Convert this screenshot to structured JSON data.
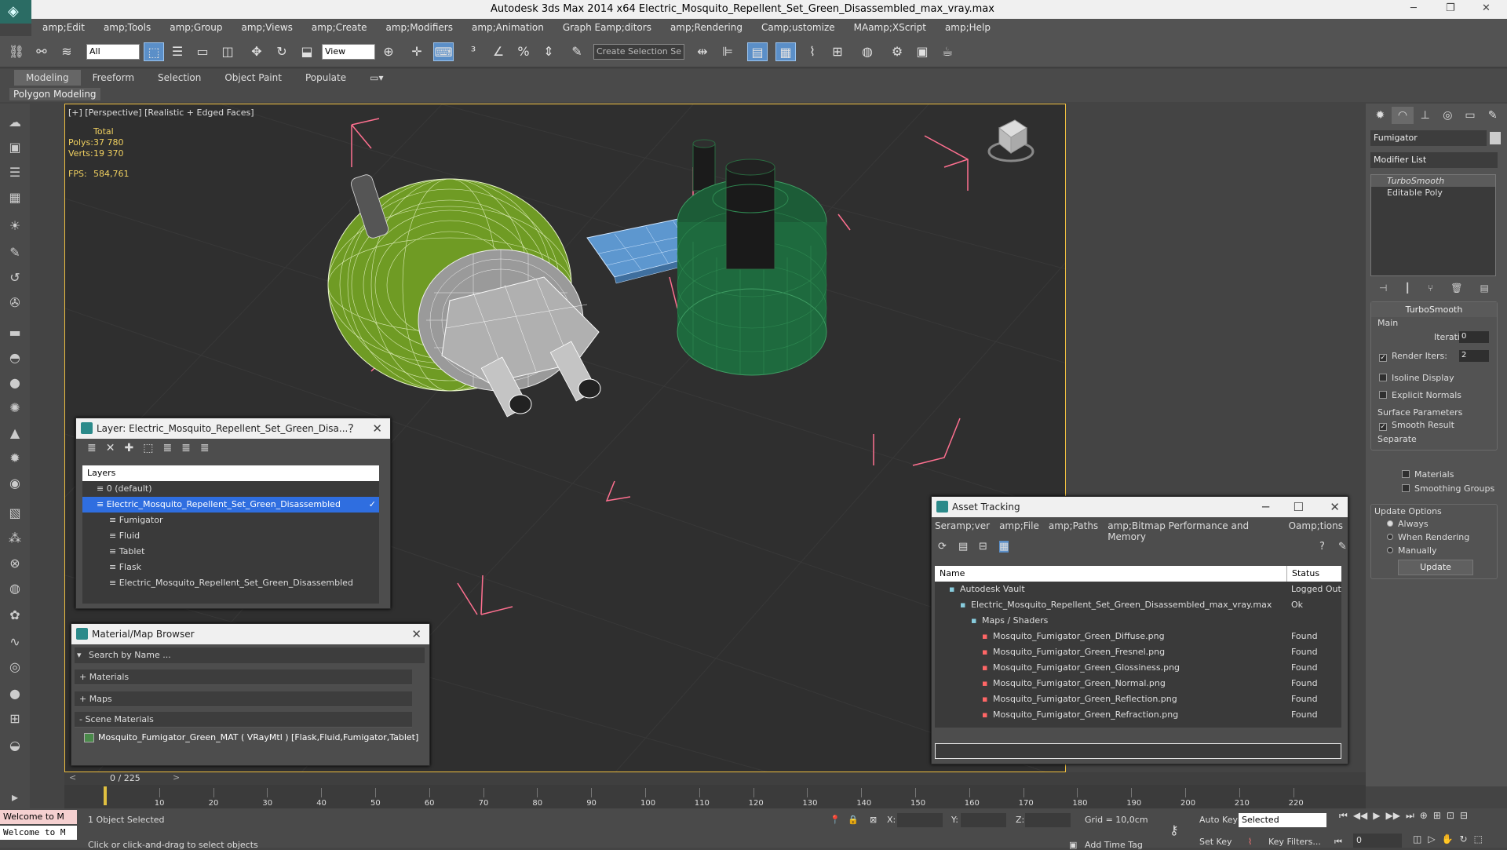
{
  "window": {
    "title": "Autodesk 3ds Max  2014 x64     Electric_Mosquito_Repellent_Set_Green_Disassembled_max_vray.max",
    "minimize": "─",
    "restore": "❐",
    "close": "✕"
  },
  "menu": [
    "amp;Edit",
    "amp;Tools",
    "amp;Group",
    "amp;Views",
    "amp;Create",
    "amp;Modifiers",
    "amp;Animation",
    "Graph Eamp;ditors",
    "amp;Rendering",
    "Camp;ustomize",
    "MAamp;XScript",
    "amp;Help"
  ],
  "toolbar": {
    "filter_select": "All",
    "ref_coord_select": "View",
    "selection_set_placeholder": "Create Selection Se"
  },
  "ribbon": {
    "tabs": [
      "Modeling",
      "Freeform",
      "Selection",
      "Object Paint",
      "Populate"
    ],
    "active_tab": "Modeling",
    "panel_label": "Polygon Modeling"
  },
  "viewport": {
    "label": "[+] [Perspective] [Realistic + Edged Faces]",
    "stats": {
      "total_label": "Total",
      "polys_label": "Polys:",
      "polys_value": "37 780",
      "verts_label": "Verts:",
      "verts_value": "19 370",
      "fps_label": "FPS:",
      "fps_value": "584,761"
    },
    "colors": {
      "background": "#2f2f2f",
      "grid": "#3a3a3a",
      "green_mesh": "#6f9b24",
      "plug_gray": "#a8a8a8",
      "tablet_blue": "#5d97cf",
      "flask_green": "#1e6a3e",
      "bbox_pink": "#ff7090"
    }
  },
  "command_panel": {
    "object_name": "Fumigator",
    "modifier_list": "Modifier List",
    "stack": [
      "TurboSmooth",
      "Editable Poly"
    ],
    "turbosmooth": {
      "title": "TurboSmooth",
      "main_label": "Main",
      "iterations_label": "Iterations:",
      "iterations_value": "0",
      "render_iters_label": "Render Iters:",
      "render_iters_value": "2",
      "isoline_label": "Isoline Display",
      "explicit_normals_label": "Explicit Normals",
      "surface_label": "Surface Parameters",
      "smooth_result_label": "Smooth Result",
      "separate_label": "Separate",
      "materials_label": "Materials",
      "smoothing_groups_label": "Smoothing Groups",
      "update_options_label": "Update Options",
      "always_label": "Always",
      "when_rendering_label": "When Rendering",
      "manually_label": "Manually",
      "update_button": "Update"
    }
  },
  "layer_window": {
    "title": "Layer: Electric_Mosquito_Repellent_Set_Green_Disa...",
    "help": "?",
    "header": "Layers",
    "rows": [
      {
        "label": "0 (default)",
        "indent": 0
      },
      {
        "label": "Electric_Mosquito_Repellent_Set_Green_Disassembled",
        "indent": 0,
        "selected": true
      },
      {
        "label": "Fumigator",
        "indent": 1
      },
      {
        "label": "Fluid",
        "indent": 1
      },
      {
        "label": "Tablet",
        "indent": 1
      },
      {
        "label": "Flask",
        "indent": 1
      },
      {
        "label": "Electric_Mosquito_Repellent_Set_Green_Disassembled",
        "indent": 1
      }
    ]
  },
  "material_browser": {
    "title": "Material/Map Browser",
    "search_placeholder": "Search by Name ...",
    "sections": [
      "+ Materials",
      "+ Maps",
      "- Scene Materials"
    ],
    "scene_material": "Mosquito_Fumigator_Green_MAT ( VRayMtl ) [Flask,Fluid,Fumigator,Tablet]"
  },
  "asset_tracking": {
    "title": "Asset Tracking",
    "menu": [
      "Seramp;ver",
      "amp;File",
      "amp;Paths",
      "amp;Bitmap Performance and Memory",
      "Oamp;tions"
    ],
    "columns": [
      "Name",
      "Status"
    ],
    "rows": [
      {
        "name": "Autodesk Vault",
        "status": "Logged Out",
        "indent": 1
      },
      {
        "name": "Electric_Mosquito_Repellent_Set_Green_Disassembled_max_vray.max",
        "status": "Ok",
        "indent": 2
      },
      {
        "name": "Maps / Shaders",
        "status": "",
        "indent": 3
      },
      {
        "name": "Mosquito_Fumigator_Green_Diffuse.png",
        "status": "Found",
        "indent": 4
      },
      {
        "name": "Mosquito_Fumigator_Green_Fresnel.png",
        "status": "Found",
        "indent": 4
      },
      {
        "name": "Mosquito_Fumigator_Green_Glossiness.png",
        "status": "Found",
        "indent": 4
      },
      {
        "name": "Mosquito_Fumigator_Green_Normal.png",
        "status": "Found",
        "indent": 4
      },
      {
        "name": "Mosquito_Fumigator_Green_Reflection.png",
        "status": "Found",
        "indent": 4
      },
      {
        "name": "Mosquito_Fumigator_Green_Refraction.png",
        "status": "Found",
        "indent": 4
      }
    ]
  },
  "timeline": {
    "frame_label": "0 / 225",
    "ticks": [
      "10",
      "20",
      "30",
      "40",
      "50",
      "60",
      "70",
      "80",
      "90",
      "100",
      "110",
      "120",
      "130",
      "140",
      "150",
      "160",
      "170",
      "180",
      "190",
      "200",
      "210",
      "220"
    ]
  },
  "status_bar": {
    "welcome": "Welcome to M",
    "selected_count": "1 Object Selected",
    "prompt": "Click or click-and-drag to select objects",
    "x_label": "X:",
    "y_label": "Y:",
    "z_label": "Z:",
    "grid": "Grid = 10,0cm",
    "auto_key": "Auto Key",
    "set_key": "Set Key",
    "key_mode_select": "Selected",
    "key_filters": "Key Filters...",
    "add_time_tag": "Add Time Tag",
    "frame_value": "0"
  }
}
